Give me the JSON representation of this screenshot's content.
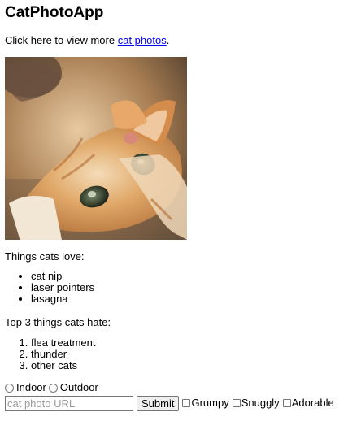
{
  "title": "CatPhotoApp",
  "intro": {
    "prefix": "Click here to view more ",
    "link_text": "cat photos",
    "suffix": "."
  },
  "photo": {
    "subject": "orange tabby kitten lying upside down"
  },
  "love": {
    "label": "Things cats love:",
    "items": [
      "cat nip",
      "laser pointers",
      "lasagna"
    ]
  },
  "hate": {
    "label": "Top 3 things cats hate:",
    "items": [
      "flea treatment",
      "thunder",
      "other cats"
    ]
  },
  "form": {
    "radios": [
      {
        "label": "Indoor",
        "checked": false
      },
      {
        "label": "Outdoor",
        "checked": false
      }
    ],
    "url_input": {
      "value": "",
      "placeholder": "cat photo URL"
    },
    "submit_label": "Submit",
    "checkboxes": [
      {
        "label": "Grumpy",
        "checked": false
      },
      {
        "label": "Snuggly",
        "checked": false
      },
      {
        "label": "Adorable",
        "checked": false
      }
    ]
  },
  "colors": {
    "link": "#0000ee",
    "text": "#000000",
    "background": "#ffffff"
  }
}
